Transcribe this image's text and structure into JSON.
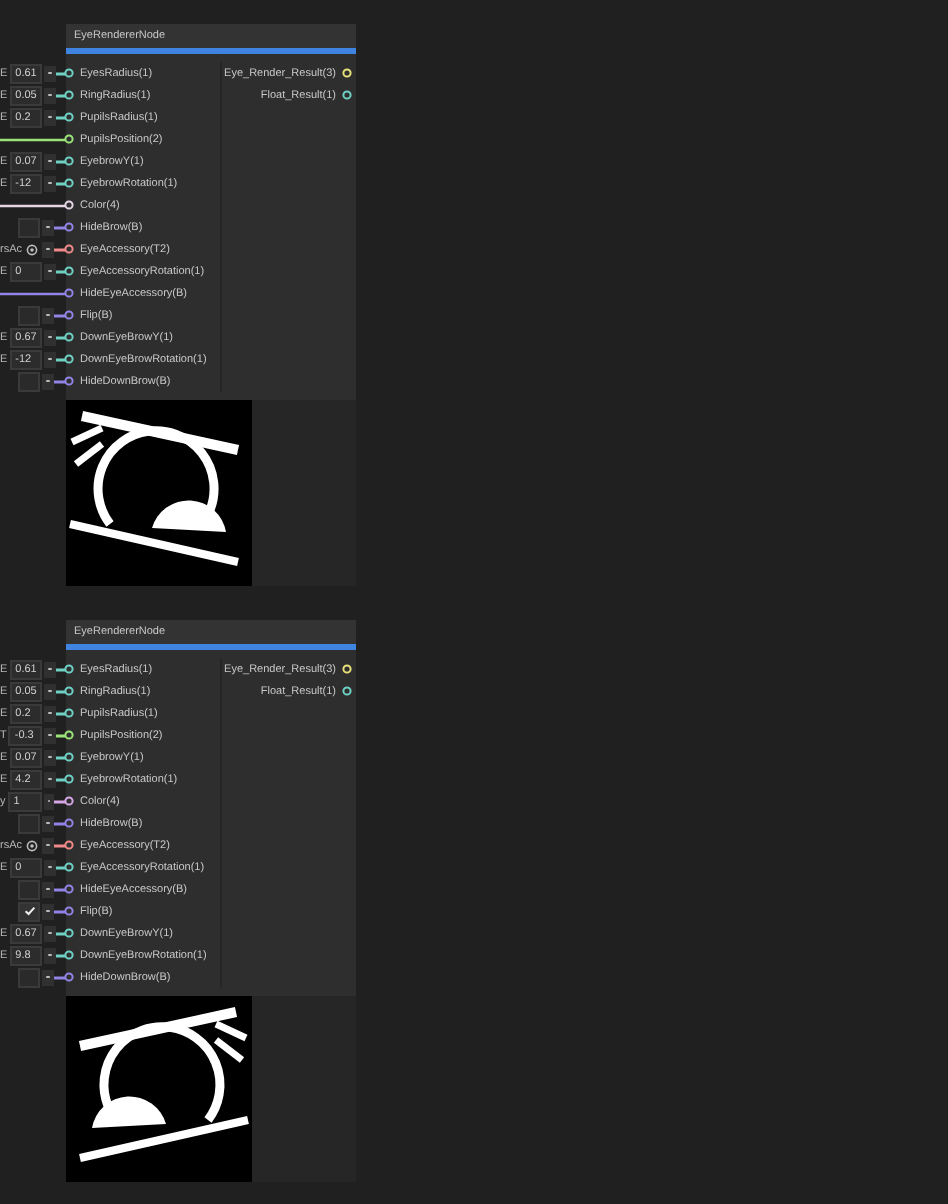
{
  "nodes": [
    {
      "title": "EyeRendererNode",
      "preview": {
        "flipped": false
      },
      "inputs": [
        {
          "name": "EyesRadius(1)",
          "color": "#6fd0c4",
          "kind": "number",
          "prefix": "E",
          "value": "0.61"
        },
        {
          "name": "RingRadius(1)",
          "color": "#6fd0c4",
          "kind": "number",
          "prefix": "E",
          "value": "0.05"
        },
        {
          "name": "PupilsRadius(1)",
          "color": "#6fd0c4",
          "kind": "number",
          "prefix": "E",
          "value": "0.2"
        },
        {
          "name": "PupilsPosition(2)",
          "color": "#9be47a",
          "kind": "edge"
        },
        {
          "name": "EyebrowY(1)",
          "color": "#6fd0c4",
          "kind": "number",
          "prefix": "E",
          "value": "0.07"
        },
        {
          "name": "EyebrowRotation(1)",
          "color": "#6fd0c4",
          "kind": "number",
          "prefix": "E",
          "value": "-12"
        },
        {
          "name": "Color(4)",
          "color": "#e6d6e6",
          "kind": "edge"
        },
        {
          "name": "HideBrow(B)",
          "color": "#9184e6",
          "kind": "checkbox",
          "checked": false
        },
        {
          "name": "EyeAccessory(T2)",
          "color": "#f08a8a",
          "kind": "texture",
          "prefix": "rsAc"
        },
        {
          "name": "EyeAccessoryRotation(1)",
          "color": "#6fd0c4",
          "kind": "number",
          "prefix": "E",
          "value": "0"
        },
        {
          "name": "HideEyeAccessory(B)",
          "color": "#9184e6",
          "kind": "edge"
        },
        {
          "name": "Flip(B)",
          "color": "#9184e6",
          "kind": "checkbox",
          "checked": false
        },
        {
          "name": "DownEyeBrowY(1)",
          "color": "#6fd0c4",
          "kind": "number",
          "prefix": "E",
          "value": "0.67"
        },
        {
          "name": "DownEyeBrowRotation(1)",
          "color": "#6fd0c4",
          "kind": "number",
          "prefix": "E",
          "value": "-12"
        },
        {
          "name": "HideDownBrow(B)",
          "color": "#9184e6",
          "kind": "checkbox",
          "checked": false
        }
      ],
      "outputs": [
        {
          "name": "Eye_Render_Result(3)",
          "color": "#e8e07a"
        },
        {
          "name": "Float_Result(1)",
          "color": "#6fd0c4"
        }
      ]
    },
    {
      "title": "EyeRendererNode",
      "preview": {
        "flipped": true
      },
      "inputs": [
        {
          "name": "EyesRadius(1)",
          "color": "#6fd0c4",
          "kind": "number",
          "prefix": "E",
          "value": "0.61"
        },
        {
          "name": "RingRadius(1)",
          "color": "#6fd0c4",
          "kind": "number",
          "prefix": "E",
          "value": "0.05"
        },
        {
          "name": "PupilsRadius(1)",
          "color": "#6fd0c4",
          "kind": "number",
          "prefix": "E",
          "value": "0.2"
        },
        {
          "name": "PupilsPosition(2)",
          "color": "#9be47a",
          "kind": "number",
          "prefix": "T",
          "value": "-0.3"
        },
        {
          "name": "EyebrowY(1)",
          "color": "#6fd0c4",
          "kind": "number",
          "prefix": "E",
          "value": "0.07"
        },
        {
          "name": "EyebrowRotation(1)",
          "color": "#6fd0c4",
          "kind": "number",
          "prefix": "E",
          "value": "4.2"
        },
        {
          "name": "Color(4)",
          "color": "#d6a6e6",
          "kind": "number",
          "prefix": "y",
          "value": "1"
        },
        {
          "name": "HideBrow(B)",
          "color": "#9184e6",
          "kind": "checkbox",
          "checked": false
        },
        {
          "name": "EyeAccessory(T2)",
          "color": "#f08a8a",
          "kind": "texture",
          "prefix": "rsAc"
        },
        {
          "name": "EyeAccessoryRotation(1)",
          "color": "#6fd0c4",
          "kind": "number",
          "prefix": "E",
          "value": "0"
        },
        {
          "name": "HideEyeAccessory(B)",
          "color": "#9184e6",
          "kind": "checkbox",
          "checked": false
        },
        {
          "name": "Flip(B)",
          "color": "#9184e6",
          "kind": "checkbox",
          "checked": true
        },
        {
          "name": "DownEyeBrowY(1)",
          "color": "#6fd0c4",
          "kind": "number",
          "prefix": "E",
          "value": "0.67"
        },
        {
          "name": "DownEyeBrowRotation(1)",
          "color": "#6fd0c4",
          "kind": "number",
          "prefix": "E",
          "value": "9.8"
        },
        {
          "name": "HideDownBrow(B)",
          "color": "#9184e6",
          "kind": "checkbox",
          "checked": false
        }
      ],
      "outputs": [
        {
          "name": "Eye_Render_Result(3)",
          "color": "#e8e07a"
        },
        {
          "name": "Float_Result(1)",
          "color": "#6fd0c4"
        }
      ]
    }
  ]
}
